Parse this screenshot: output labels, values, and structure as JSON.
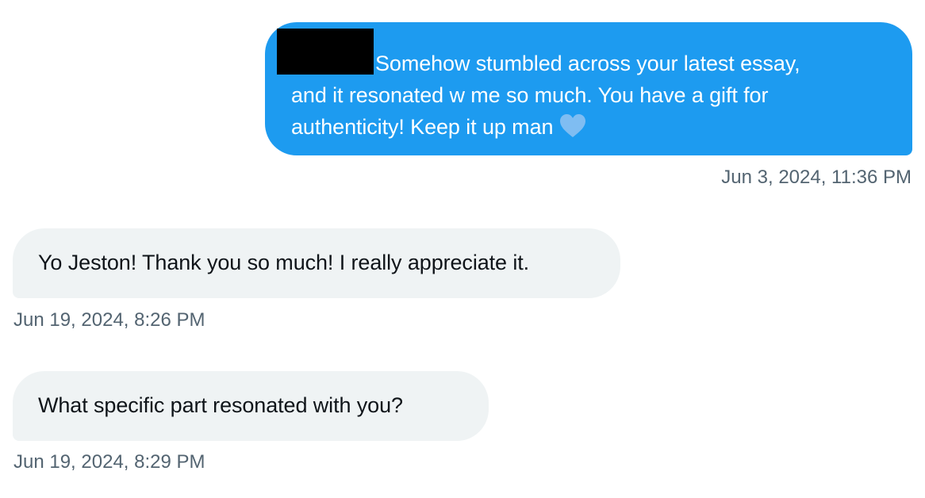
{
  "messages": [
    {
      "direction": "outgoing",
      "text_line1": "Somehow stumbled across your latest essay,",
      "text_line2": "and it resonated w me so much. You have a gift for",
      "text_line3": "authenticity! Keep it up man",
      "emoji": "light-blue-heart-icon",
      "timestamp": "Jun 3, 2024, 11:36 PM"
    },
    {
      "direction": "incoming",
      "text": "Yo Jeston! Thank you so much! I really appreciate it.",
      "timestamp": "Jun 19, 2024, 8:26 PM"
    },
    {
      "direction": "incoming",
      "text": "What specific part resonated with you?",
      "timestamp": "Jun 19, 2024, 8:29 PM"
    }
  ],
  "colors": {
    "outgoing_bubble": "#1d9bf0",
    "incoming_bubble": "#eff3f4",
    "timestamp_text": "#536471",
    "heart": "#7fbdf2"
  }
}
